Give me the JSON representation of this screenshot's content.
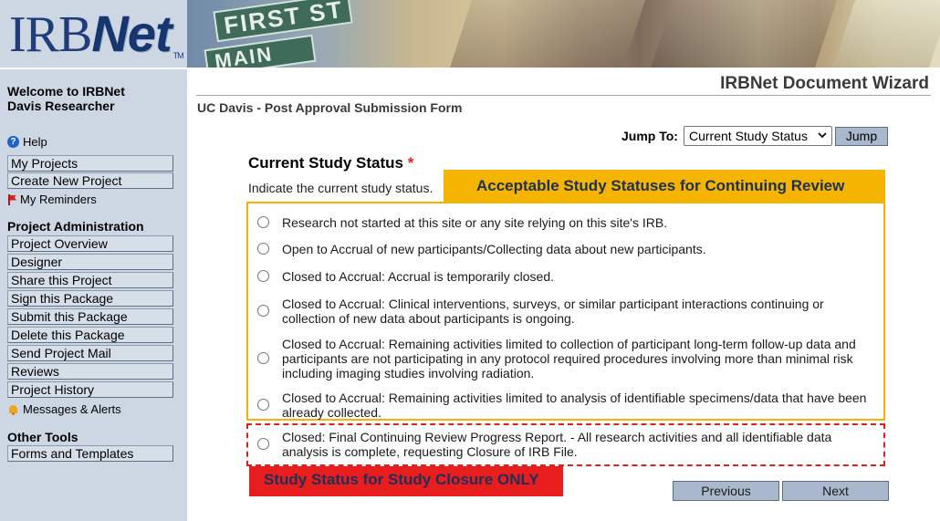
{
  "header": {
    "logo_main": "IRB",
    "logo_net": "Net",
    "logo_tm": "TM",
    "banner_sign_1": "FIRST ST",
    "banner_sign_2": "MAIN"
  },
  "sidebar": {
    "welcome_line1": "Welcome to IRBNet",
    "welcome_line2": "Davis Researcher",
    "help": "Help",
    "my_projects": "My Projects",
    "create_new_project": "Create New Project",
    "my_reminders": "My Reminders",
    "project_admin_title": "Project Administration",
    "admin_items": [
      "Project Overview",
      "Designer",
      "Share this Project",
      "Sign this Package",
      "Submit this Package",
      "Delete this Package",
      "Send Project Mail",
      "Reviews",
      "Project History"
    ],
    "messages_alerts": "Messages & Alerts",
    "other_tools_title": "Other Tools",
    "forms_templates": "Forms and Templates"
  },
  "main": {
    "wizard_title": "IRBNet Document Wizard",
    "form_name": "UC Davis - Post Approval Submission Form",
    "jump_label": "Jump To:",
    "jump_selected": "Current Study Status",
    "jump_button": "Jump",
    "question_title": "Current Study Status",
    "required_mark": "*",
    "question_help": "Indicate the current study status.",
    "accept_label": "Acceptable Study Statuses for Continuing Review",
    "closure_label": "Study Status for Study Closure ONLY",
    "options": [
      "Research not started at this site or any site relying on this site's IRB.",
      "Open to Accrual of new participants/Collecting data about new participants.",
      "Closed to Accrual: Accrual is temporarily closed.",
      "Closed to Accrual: Clinical interventions, surveys, or similar participant interactions continuing or collection of new data about participants is ongoing.",
      "Closed to Accrual: Remaining activities limited to collection of participant long-term follow-up data and participants are not participating in any protocol required procedures involving more than minimal risk including imaging studies involving radiation.",
      "Closed to Accrual: Remaining activities limited to analysis of identifiable specimens/data that have been already collected.",
      "Closed: Final Continuing Review Progress Report. - All research activities and all identifiable data analysis is complete, requesting Closure of IRB File."
    ],
    "previous_button": "Previous",
    "next_button": "Next"
  },
  "colors": {
    "sidebar_bg": "#cdd7e3",
    "button_bg": "#a9b8cd",
    "accept_highlight": "#f4b400",
    "closure_highlight": "#e81e1e",
    "required_star": "#e4201a"
  }
}
